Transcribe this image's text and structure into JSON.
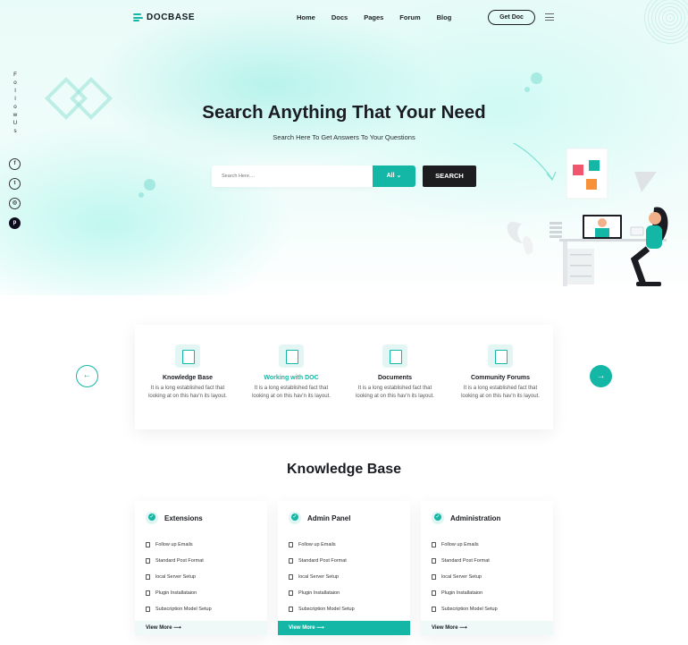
{
  "brand": {
    "name": "DOCBASE",
    "accent": "#14b6a6",
    "dark": "#1d1d1f"
  },
  "nav": {
    "items": [
      "Home",
      "Docs",
      "Pages",
      "Forum",
      "Blog"
    ],
    "cta": "Get Doc",
    "menu_icon": "hamburger-icon"
  },
  "follow": {
    "letters": [
      "F",
      "o",
      "l",
      "l",
      "o",
      "w",
      "U",
      "s"
    ],
    "socials": [
      "facebook-icon",
      "twitter-icon",
      "instagram-icon",
      "pinterest-icon"
    ],
    "social_glyphs": [
      "f",
      "t",
      "◎",
      "p"
    ]
  },
  "hero": {
    "title": "Search Anything That Your Need",
    "subtitle": "Search Here To Get Answers To Your Questions",
    "search_placeholder": "Search Here....",
    "filter_label": "All",
    "search_button": "SEARCH"
  },
  "categories": [
    {
      "title": "Knowledge Base",
      "desc": "It is a long established fact that looking at on this hav'n its layout.",
      "active": false
    },
    {
      "title": "Working with DOC",
      "desc": "It is a long established fact that looking at on this hav'n its layout.",
      "active": true
    },
    {
      "title": "Documents",
      "desc": "It is a long established fact that looking at on this hav'n its layout.",
      "active": false
    },
    {
      "title": "Community Forums",
      "desc": "It is a long established fact that looking at on this hav'n its layout.",
      "active": false
    }
  ],
  "knowledge": {
    "title": "Knowledge Base",
    "cards": [
      {
        "name": "Extensions",
        "items": [
          "Follow up Emails",
          "Standard Post Format",
          "local Server Setup",
          "Plugin Installataion",
          "Subscription Model Setup"
        ],
        "more": "View More",
        "active": false
      },
      {
        "name": "Admin Panel",
        "items": [
          "Follow up Emails",
          "Standard Post Format",
          "local Server Setup",
          "Plugin Installataion",
          "Subscription Model Setup"
        ],
        "more": "View More",
        "active": true
      },
      {
        "name": "Administration",
        "items": [
          "Follow up Emails",
          "Standard Post Format",
          "local Server Setup",
          "Plugin Installataion",
          "Subscription Model Setup"
        ],
        "more": "View More",
        "active": false
      }
    ]
  }
}
